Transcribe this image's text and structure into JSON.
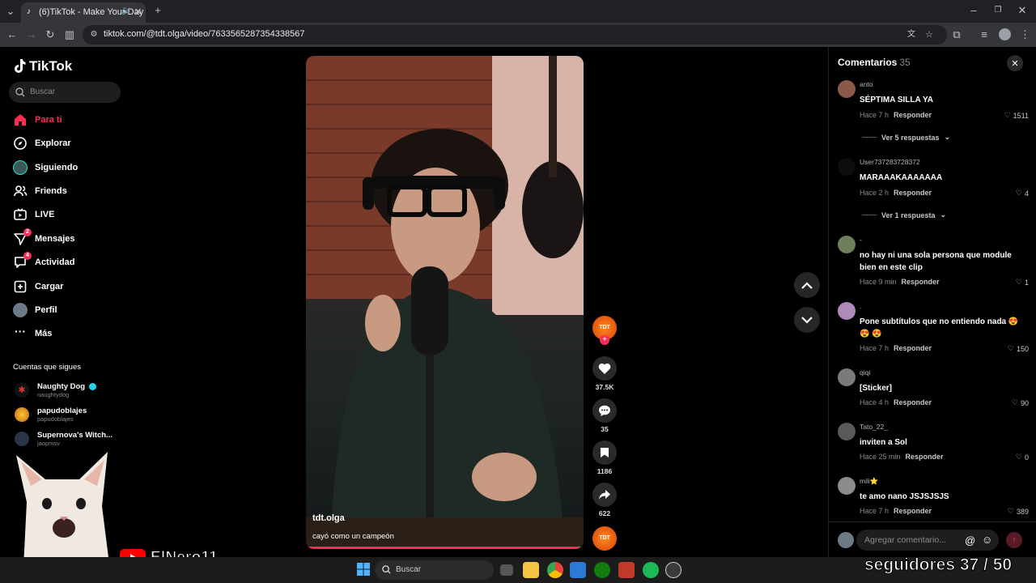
{
  "browser": {
    "tab_title": "(6)TikTok - Make Your Day",
    "url": "tiktok.com/@tdt.olga/video/7633565287354338567"
  },
  "sidebar": {
    "logo": "TikTok",
    "search_placeholder": "Buscar",
    "nav": [
      {
        "label": "Para ti",
        "icon": "home-icon"
      },
      {
        "label": "Explorar",
        "icon": "compass-icon"
      },
      {
        "label": "Siguiendo",
        "icon": "following-avatar-icon"
      },
      {
        "label": "Friends",
        "icon": "friends-icon"
      },
      {
        "label": "LIVE",
        "icon": "live-icon"
      },
      {
        "label": "Mensajes",
        "icon": "messages-icon",
        "badge": "2"
      },
      {
        "label": "Actividad",
        "icon": "activity-icon",
        "badge": "4"
      },
      {
        "label": "Cargar",
        "icon": "upload-icon"
      },
      {
        "label": "Perfil",
        "icon": "profile-avatar-icon"
      },
      {
        "label": "Más",
        "icon": "more-dots-icon"
      }
    ],
    "following_title": "Cuentas que sigues",
    "accounts": [
      {
        "name": "Naughty Dog",
        "username": "naughtydog",
        "verified": true
      },
      {
        "name": "papudoblajes",
        "username": "papudoblajes"
      },
      {
        "name": "Supernova's Witch...",
        "username": "jaopmsv"
      }
    ]
  },
  "video": {
    "author": "tdt.olga",
    "caption": "cayó como un campeón",
    "progress": 1.0
  },
  "actions": {
    "likes": "37.5K",
    "comments": "35",
    "saves": "1186",
    "shares": "622"
  },
  "comments_panel": {
    "title": "Comentarios",
    "count": "35",
    "input_placeholder": "Agregar comentario...",
    "items": [
      {
        "user": "anto",
        "text": "SÉPTIMA SILLA YA",
        "time": "Hace 7 h",
        "reply": "Responder",
        "likes": "1511",
        "more": "Ver 5 respuestas"
      },
      {
        "user": "User737283728372",
        "text": "MARAAAKAAAAAAA",
        "time": "Hace 2 h",
        "reply": "Responder",
        "likes": "4",
        "more": "Ver 1 respuesta"
      },
      {
        "user": "-",
        "text": "no hay ni una sola persona que module bien en este clip",
        "time": "Hace 9 min",
        "reply": "Responder",
        "likes": "1"
      },
      {
        "user": ".",
        "text": "Pone subtítulos que no entiendo nada 😍 😍 😍",
        "time": "Hace 7 h",
        "reply": "Responder",
        "likes": "150"
      },
      {
        "user": "qiqi",
        "text": "[Sticker]",
        "time": "Hace 4 h",
        "reply": "Responder",
        "likes": "90"
      },
      {
        "user": "Tato_22_",
        "text": "inviten a Sol",
        "time": "Hace 25 min",
        "reply": "Responder",
        "likes": "0"
      },
      {
        "user": "mili⭐",
        "text": "te amo nano JSJSJSJS",
        "time": "Hace 7 h",
        "reply": "Responder",
        "likes": "389"
      }
    ]
  },
  "taskbar": {
    "search_placeholder": "Buscar"
  },
  "overlay": {
    "channel": "ElNero11",
    "followers": "seguidores 37 / 50"
  },
  "colors": {
    "accent": "#fe2c55",
    "background": "#000000"
  }
}
